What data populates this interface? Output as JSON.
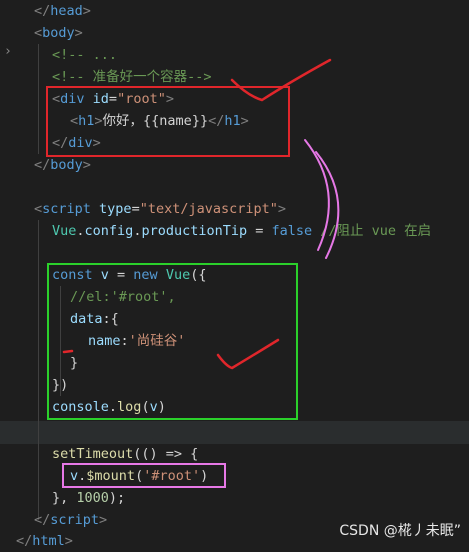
{
  "editor": {
    "lines": {
      "l1_close": "</",
      "l1_tag": "head",
      "l1_end": ">",
      "l2_open": "<",
      "l2_tag": "body",
      "l2_end": ">",
      "l3": "<!-- ...",
      "l4": "<!-- 准备好一个容器-->",
      "l5_open": "<",
      "l5_tag": "div",
      "l5_attr": " id",
      "l5_eq": "=",
      "l5_val": "\"root\"",
      "l5_end": ">",
      "l6_open": "<",
      "l6_tag": "h1",
      "l6_gt": ">",
      "l6_text": "你好，{{name}}",
      "l6_close": "</",
      "l6_tag2": "h1",
      "l6_end": ">",
      "l7_close": "</",
      "l7_tag": "div",
      "l7_end": ">",
      "l8_close": "</",
      "l8_tag": "body",
      "l8_end": ">",
      "l10_open": "<",
      "l10_tag": "script",
      "l10_attr": " type",
      "l10_eq": "=",
      "l10_val": "\"text/javascript\"",
      "l10_end": ">",
      "l11_cls": "Vue",
      "l11_dot1": ".",
      "l11_p1": "config",
      "l11_dot2": ".",
      "l11_p2": "productionTip",
      "l11_eq": " = ",
      "l11_val": "false",
      "l11_com": " //阻止 vue 在启",
      "l13_kw": "const",
      "l13_var": " v",
      "l13_eq": " = ",
      "l13_new": "new",
      "l13_cls": " Vue",
      "l13_end": "({",
      "l14": "//el:'#root',",
      "l15_prop": "data",
      "l15_end": ":{",
      "l16_prop": "name",
      "l16_colon": ":",
      "l16_val": "'尚硅谷'",
      "l17": "}",
      "l18": "})",
      "l19_obj": "console",
      "l19_dot": ".",
      "l19_fn": "log",
      "l19_open": "(",
      "l19_arg": "v",
      "l19_close": ")",
      "l21_fn": "setTimeout",
      "l21_rest": "(() => {",
      "l22_var": "v",
      "l22_dot": ".",
      "l22_fn": "$mount",
      "l22_open": "(",
      "l22_arg": "'#root'",
      "l22_close": ")",
      "l23_pre": "}, ",
      "l23_num": "1000",
      "l23_end": ");",
      "l24_close": "</",
      "l24_tag": "script",
      "l24_end": ">",
      "l25_close": "</",
      "l25_tag": "html",
      "l25_end": ">"
    }
  },
  "annotations": {
    "red_box_color": "#e0262b",
    "green_box_color": "#2bd12b",
    "pink_box_color": "#e678e6"
  },
  "watermark": "CSDN @椛丿未眠”"
}
